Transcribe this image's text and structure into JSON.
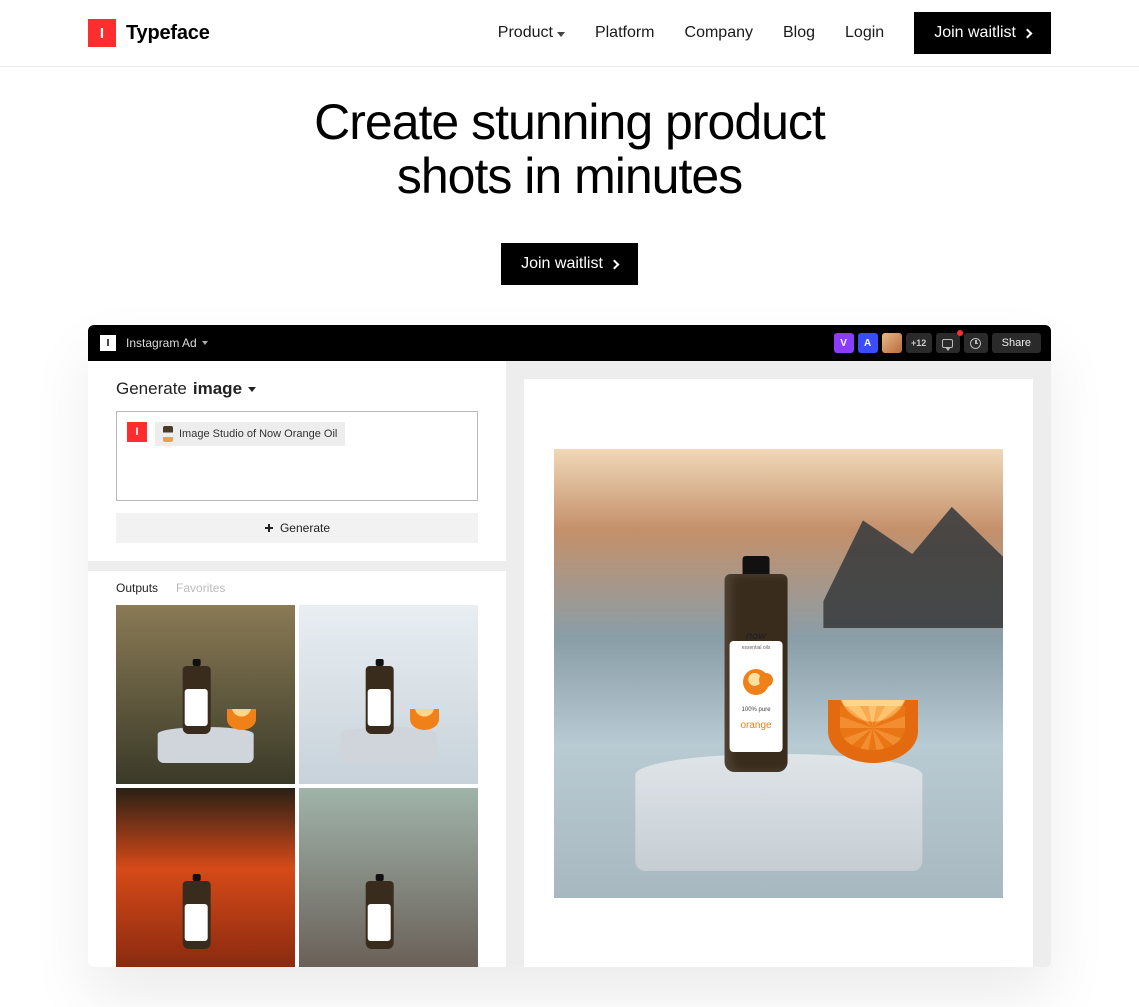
{
  "nav": {
    "brand": "Typeface",
    "links": {
      "product": "Product",
      "platform": "Platform",
      "company": "Company",
      "blog": "Blog",
      "login": "Login"
    },
    "cta": "Join waitlist"
  },
  "hero": {
    "headline_line1": "Create stunning product",
    "headline_line2": "shots in minutes",
    "cta": "Join waitlist"
  },
  "app": {
    "title": "Instagram Ad",
    "avatars": {
      "v": "V",
      "a": "A",
      "overflow": "+12"
    },
    "share": "Share",
    "generate_section": {
      "head_prefix": "Generate",
      "head_bold": "image",
      "chip_label": "Image Studio of Now Orange Oil",
      "button": "Generate"
    },
    "tabs": {
      "outputs": "Outputs",
      "favorites": "Favorites"
    },
    "product_label": {
      "brand": "now",
      "brand_sub": "essential oils",
      "line1": "100% pure",
      "line2": "orange"
    }
  }
}
